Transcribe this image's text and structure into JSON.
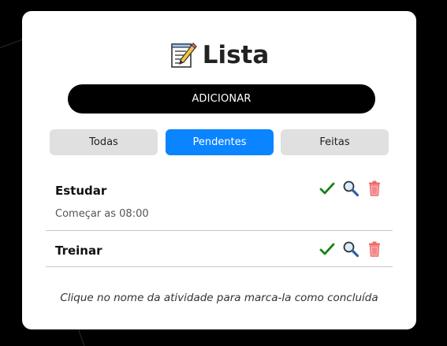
{
  "header": {
    "icon": "memo-icon",
    "title": "Lista"
  },
  "add_button": {
    "label": "ADICIONAR"
  },
  "filters": {
    "active": "Pendentes",
    "tabs": [
      {
        "label": "Todas"
      },
      {
        "label": "Pendentes"
      },
      {
        "label": "Feitas"
      }
    ]
  },
  "tasks": [
    {
      "name": "Estudar",
      "description": "Começar as 08:00"
    },
    {
      "name": "Treinar",
      "description": ""
    }
  ],
  "actions": {
    "done_icon": "check-icon",
    "view_icon": "magnifier-icon",
    "delete_icon": "trash-icon"
  },
  "hint": "Clique no nome da atividade para marca-la como concluída",
  "colors": {
    "accent": "#0a84ff",
    "button": "#000000",
    "tab_inactive": "#e0e0e0",
    "check": "#2ea02e",
    "trash": "#f06a6a"
  }
}
